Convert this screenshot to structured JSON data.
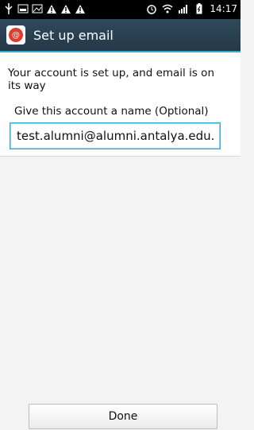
{
  "status_bar": {
    "time": "14:17",
    "icons": [
      "usb-icon",
      "screenshot-icon",
      "gallery-icon",
      "warning-icon",
      "warning-icon",
      "warning-icon",
      "alarm-icon",
      "wifi-icon",
      "signal-icon",
      "battery-icon"
    ]
  },
  "action_bar": {
    "title": "Set up email",
    "icon": "email-app-icon"
  },
  "main": {
    "message": "Your account is set up, and email is on its way",
    "name_label": "Give this account a name (Optional)",
    "name_value": "test.alumni@alumni.antalya.edu.tr"
  },
  "footer": {
    "done_label": "Done"
  },
  "colors": {
    "accent": "#3aa7d8",
    "action_bar_bg": "#2f4a5c",
    "app_icon_red": "#e23a2c"
  }
}
